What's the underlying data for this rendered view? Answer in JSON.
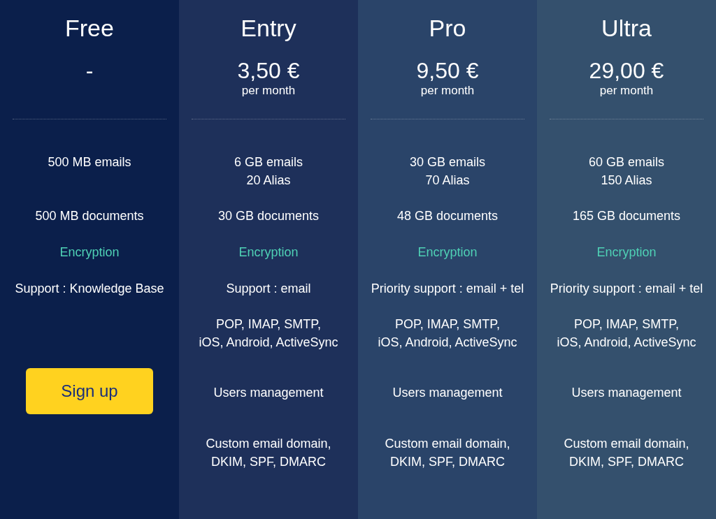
{
  "plans": [
    {
      "name": "Free",
      "price": "-",
      "color": "#0b1f4b",
      "features": [
        {
          "kind": "text",
          "lines": [
            "500 MB emails"
          ]
        },
        {
          "kind": "text",
          "lines": [
            "500 MB documents"
          ]
        },
        {
          "kind": "accent",
          "lines": [
            "Encryption"
          ]
        },
        {
          "kind": "text",
          "lines": [
            "Support : Knowledge Base"
          ]
        }
      ],
      "button": "Sign up"
    },
    {
      "name": "Entry",
      "price": "3,50 €",
      "period": "per month",
      "color": "#1e305a",
      "features": [
        {
          "kind": "text",
          "lines": [
            "6 GB emails",
            "20 Alias"
          ]
        },
        {
          "kind": "text",
          "lines": [
            "30 GB documents"
          ]
        },
        {
          "kind": "accent",
          "lines": [
            "Encryption"
          ]
        },
        {
          "kind": "text",
          "lines": [
            "Support : email"
          ]
        },
        {
          "kind": "text",
          "lines": [
            "POP, IMAP, SMTP,",
            "iOS, Android, ActiveSync"
          ]
        },
        {
          "kind": "text",
          "lines": [
            "Users management"
          ]
        },
        {
          "kind": "text",
          "lines": [
            "Custom email domain,",
            "DKIM, SPF, DMARC"
          ]
        }
      ]
    },
    {
      "name": "Pro",
      "price": "9,50 €",
      "period": "per month",
      "color": "#2a4469",
      "features": [
        {
          "kind": "text",
          "lines": [
            "30 GB emails",
            "70 Alias"
          ]
        },
        {
          "kind": "text",
          "lines": [
            "48 GB documents"
          ]
        },
        {
          "kind": "accent",
          "lines": [
            "Encryption"
          ]
        },
        {
          "kind": "text",
          "lines": [
            "Priority support : email + tel"
          ]
        },
        {
          "kind": "text",
          "lines": [
            "POP, IMAP, SMTP,",
            "iOS, Android, ActiveSync"
          ]
        },
        {
          "kind": "text",
          "lines": [
            "Users management"
          ]
        },
        {
          "kind": "text",
          "lines": [
            "Custom email domain,",
            "DKIM, SPF, DMARC"
          ]
        }
      ]
    },
    {
      "name": "Ultra",
      "price": "29,00 €",
      "period": "per month",
      "color": "#34506d",
      "features": [
        {
          "kind": "text",
          "lines": [
            "60 GB emails",
            "150 Alias"
          ]
        },
        {
          "kind": "text",
          "lines": [
            "165 GB documents"
          ]
        },
        {
          "kind": "accent",
          "lines": [
            "Encryption"
          ]
        },
        {
          "kind": "text",
          "lines": [
            "Priority support : email + tel"
          ]
        },
        {
          "kind": "text",
          "lines": [
            "POP, IMAP, SMTP,",
            "iOS, Android, ActiveSync"
          ]
        },
        {
          "kind": "text",
          "lines": [
            "Users management"
          ]
        },
        {
          "kind": "text",
          "lines": [
            "Custom email domain,",
            "DKIM, SPF, DMARC"
          ]
        }
      ]
    }
  ]
}
